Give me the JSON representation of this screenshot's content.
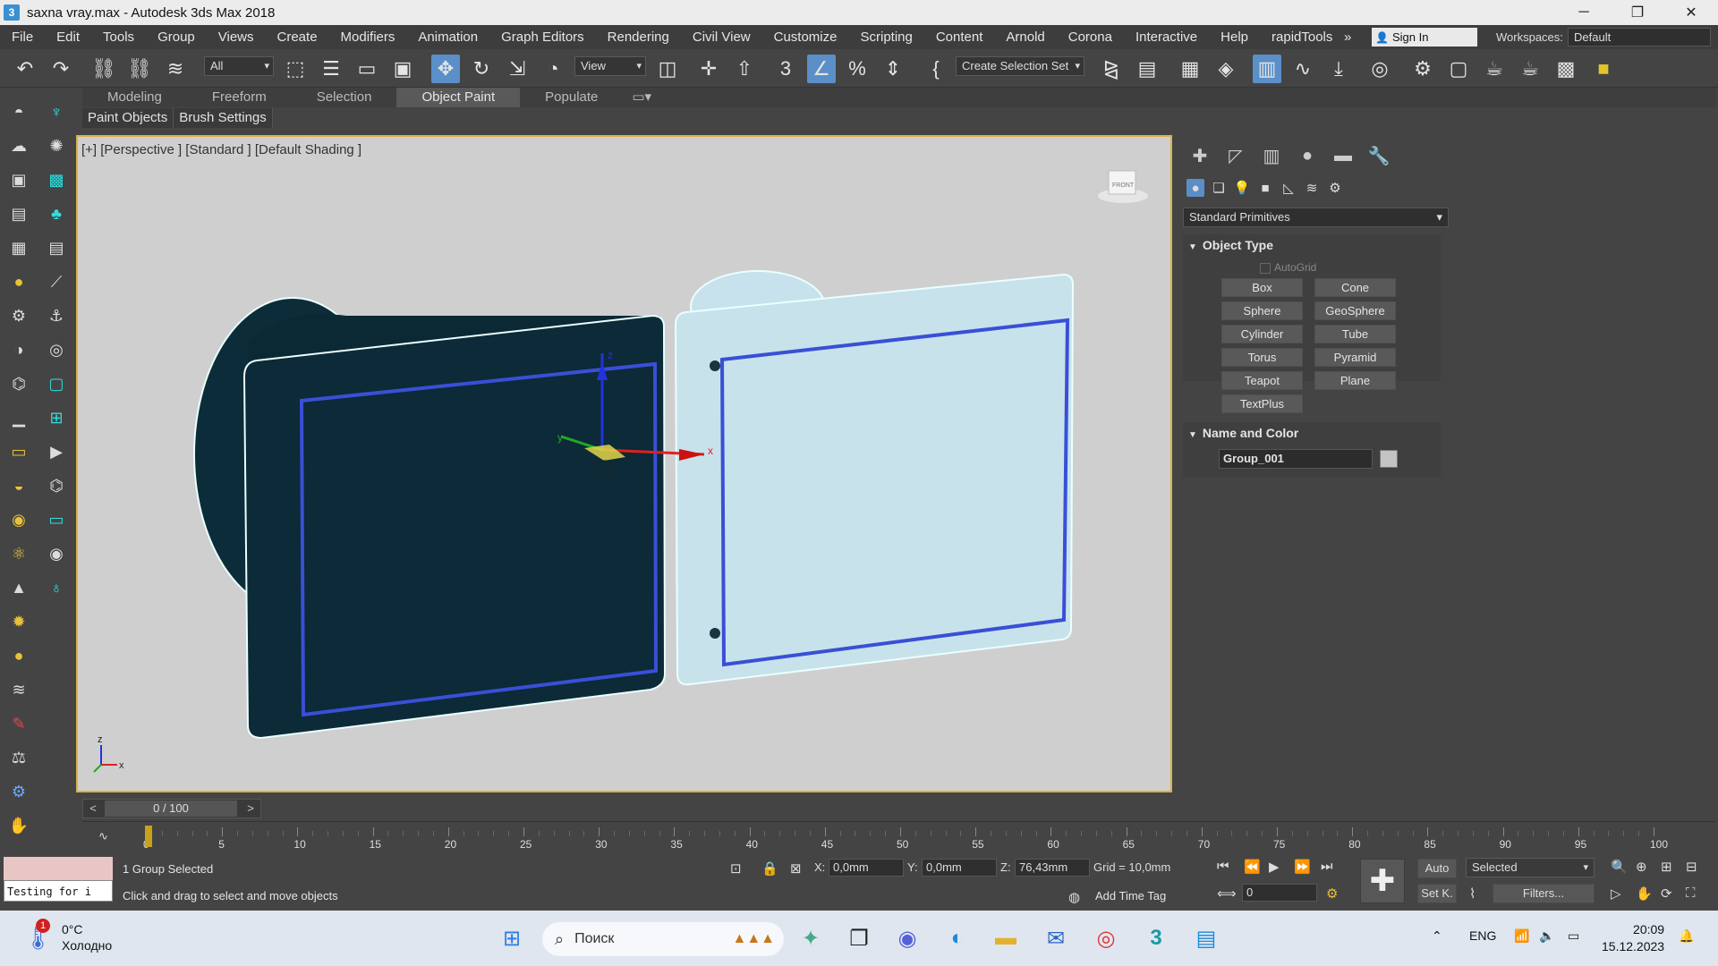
{
  "window": {
    "title": "saxna vray.max - Autodesk 3ds Max 2018",
    "app_icon": "3",
    "controls": [
      "─",
      "❐",
      "✕"
    ]
  },
  "menu": {
    "items": [
      "File",
      "Edit",
      "Tools",
      "Group",
      "Views",
      "Create",
      "Modifiers",
      "Animation",
      "Graph Editors",
      "Rendering",
      "Civil View",
      "Customize",
      "Scripting",
      "Content",
      "Arnold",
      "Corona",
      "Interactive",
      "Help",
      "rapidTools"
    ],
    "overflow": "»",
    "sign_in": "Sign In",
    "workspaces_label": "Workspaces:",
    "workspace_value": "Default"
  },
  "toolbar": {
    "selection_filter": "All",
    "ref_coord": "View",
    "selection_set_placeholder": "Create Selection Set",
    "snap_3d": "3",
    "percent": "%"
  },
  "ribbon": {
    "tabs": [
      "Modeling",
      "Freeform",
      "Selection",
      "Object Paint",
      "Populate"
    ],
    "active_tab": "Object Paint",
    "sub_tabs": [
      "Paint Objects",
      "Brush Settings"
    ]
  },
  "viewport": {
    "label": "[+] [Perspective ] [Standard ] [Default Shading ]",
    "viewcube_label": "FRONT",
    "axis_z": "z",
    "axis_x": "x",
    "gizmo_x": "x",
    "gizmo_y": "y",
    "gizmo_z": "z",
    "colors": {
      "background": "#cfcfcf",
      "dark_object": "#0c2b38",
      "light_object": "#c7e2ec",
      "frame_edge": "#3a4fd6",
      "selection_outline": "#eaffff"
    }
  },
  "command_panel": {
    "dropdown": "Standard Primitives",
    "object_type": {
      "title": "Object Type",
      "autogrid": "AutoGrid",
      "buttons": [
        "Box",
        "Cone",
        "Sphere",
        "GeoSphere",
        "Cylinder",
        "Tube",
        "Torus",
        "Pyramid",
        "Teapot",
        "Plane",
        "TextPlus"
      ]
    },
    "name_color": {
      "title": "Name and Color",
      "name_value": "Group_001",
      "color": "#c3c3c3"
    }
  },
  "timeline": {
    "slider_text": "0 / 100",
    "prev": "<",
    "next": ">",
    "ticks": [
      "0",
      "5",
      "10",
      "15",
      "20",
      "25",
      "30",
      "35",
      "40",
      "45",
      "50",
      "55",
      "60",
      "65",
      "70",
      "75",
      "80",
      "85",
      "90",
      "95",
      "100"
    ]
  },
  "status": {
    "maxscript_text": "Testing for i",
    "selection_text": "1 Group Selected",
    "prompt_text": "Click and drag to select and move objects",
    "x_label": "X:",
    "x_value": "0,0mm",
    "y_label": "Y:",
    "y_value": "0,0mm",
    "z_label": "Z:",
    "z_value": "76,43mm",
    "grid": "Grid = 10,0mm",
    "add_time_tag": "Add Time Tag",
    "auto_label": "Auto",
    "selected_dropdown": "Selected",
    "frame_value": "0",
    "setkey_label": "Set K.",
    "filters_label": "Filters..."
  },
  "taskbar": {
    "weather_badge": "1",
    "temperature": "0°C",
    "weather_desc": "Холодно",
    "search_placeholder": "Поиск",
    "language": "ENG",
    "time": "20:09",
    "date": "15.12.2023"
  }
}
